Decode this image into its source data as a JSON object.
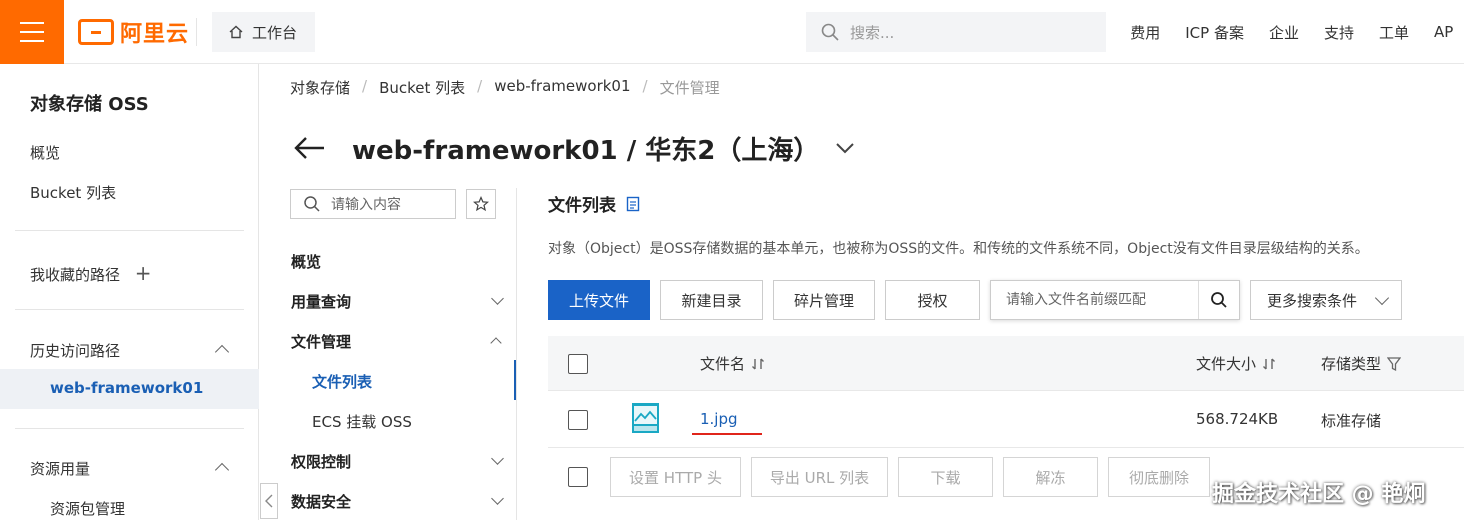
{
  "header": {
    "logo_text": "阿里云",
    "workbench_label": "工作台",
    "search_placeholder": "搜索...",
    "nav": [
      "费用",
      "ICP 备案",
      "企业",
      "支持",
      "工单",
      "AP"
    ]
  },
  "sidebar": {
    "title": "对象存储 OSS",
    "overview": "概览",
    "bucket_list": "Bucket 列表",
    "favorites": "我收藏的路径",
    "history": "历史访问路径",
    "history_item": "web-framework01",
    "resources": "资源用量",
    "resource_pkg": "资源包管理"
  },
  "breadcrumb": [
    "对象存储",
    "Bucket 列表",
    "web-framework01",
    "文件管理"
  ],
  "page_title": "web-framework01 / 华东2（上海）",
  "sub_nav": {
    "search_placeholder": "请输入内容",
    "items": {
      "overview": "概览",
      "usage": "用量查询",
      "file_mgmt": "文件管理",
      "file_list": "文件列表",
      "ecs_mount": "ECS 挂载 OSS",
      "access": "权限控制",
      "data_security": "数据安全"
    }
  },
  "main": {
    "list_title": "文件列表",
    "description": "对象（Object）是OSS存储数据的基本单元，也被称为OSS的文件。和传统的文件系统不同，Object没有文件目录层级结构的关系。",
    "buttons": {
      "upload": "上传文件",
      "new_dir": "新建目录",
      "fragments": "碎片管理",
      "authorize": "授权"
    },
    "file_search_placeholder": "请输入文件名前缀匹配",
    "more_search": "更多搜索条件",
    "columns": {
      "name": "文件名",
      "size": "文件大小",
      "storage": "存储类型"
    },
    "rows": [
      {
        "name": "1.jpg",
        "size": "568.724KB",
        "storage": "标准存储"
      }
    ],
    "batch_buttons": {
      "set_http": "设置 HTTP 头",
      "export_url": "导出 URL 列表",
      "download": "下载",
      "unfreeze": "解冻",
      "delete": "彻底删除"
    }
  },
  "watermark": "掘金技术社区 @ 艳炯",
  "colors": {
    "brand": "#ff6a00",
    "primary": "#1a63c7",
    "link": "#1a5fb4",
    "underline": "#e0251b"
  }
}
